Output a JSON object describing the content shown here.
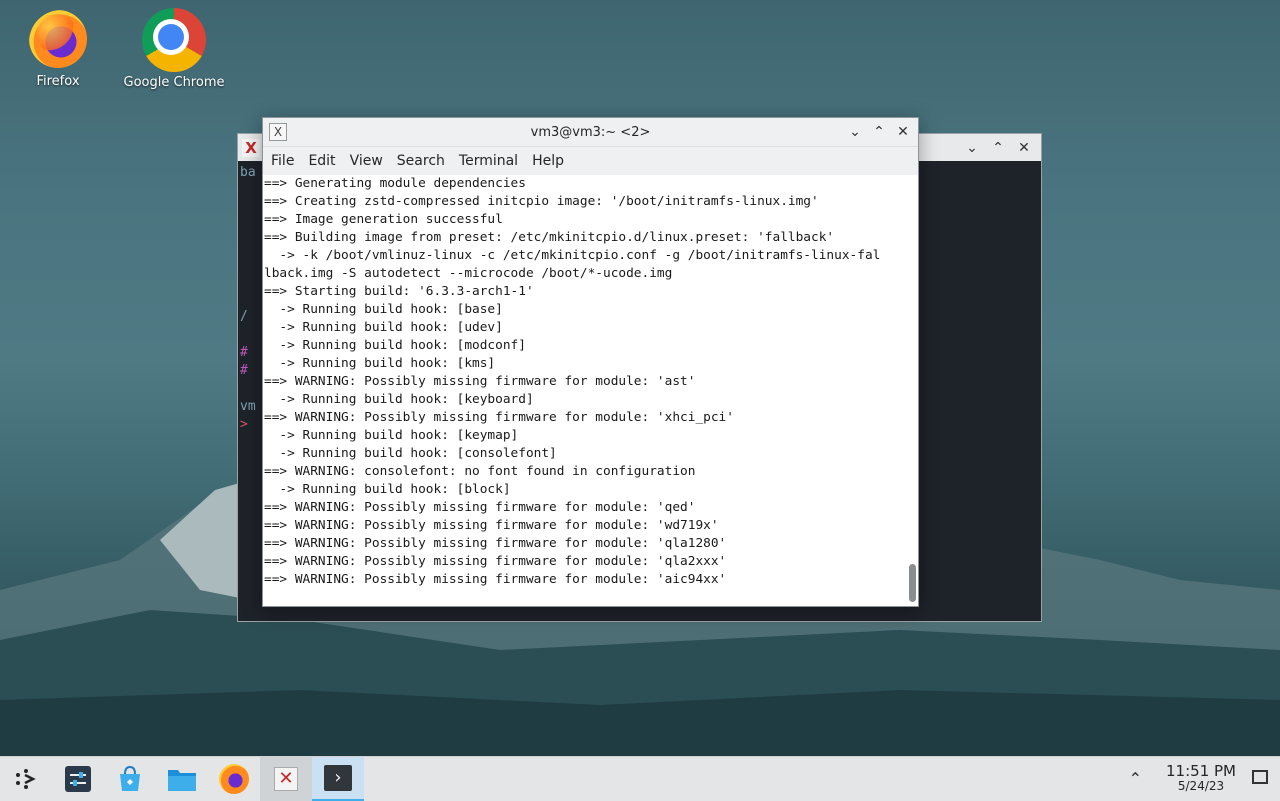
{
  "desktop": {
    "icons": [
      {
        "label": "Firefox",
        "icon": "firefox-icon"
      },
      {
        "label": "Google Chrome",
        "icon": "chrome-icon"
      }
    ]
  },
  "back_window": {
    "side_text": [
      "ba",
      "/",
      "#",
      "#",
      "vm",
      ">"
    ]
  },
  "terminal": {
    "title": "vm3@vm3:~ <2>",
    "menu": [
      "File",
      "Edit",
      "View",
      "Search",
      "Terminal",
      "Help"
    ],
    "lines": [
      "==> Generating module dependencies",
      "==> Creating zstd-compressed initcpio image: '/boot/initramfs-linux.img'",
      "==> Image generation successful",
      "==> Building image from preset: /etc/mkinitcpio.d/linux.preset: 'fallback'",
      "  -> -k /boot/vmlinuz-linux -c /etc/mkinitcpio.conf -g /boot/initramfs-linux-fal",
      "lback.img -S autodetect --microcode /boot/*-ucode.img",
      "==> Starting build: '6.3.3-arch1-1'",
      "  -> Running build hook: [base]",
      "  -> Running build hook: [udev]",
      "  -> Running build hook: [modconf]",
      "  -> Running build hook: [kms]",
      "==> WARNING: Possibly missing firmware for module: 'ast'",
      "  -> Running build hook: [keyboard]",
      "==> WARNING: Possibly missing firmware for module: 'xhci_pci'",
      "  -> Running build hook: [keymap]",
      "  -> Running build hook: [consolefont]",
      "==> WARNING: consolefont: no font found in configuration",
      "  -> Running build hook: [block]",
      "==> WARNING: Possibly missing firmware for module: 'qed'",
      "==> WARNING: Possibly missing firmware for module: 'wd719x'",
      "==> WARNING: Possibly missing firmware for module: 'qla1280'",
      "==> WARNING: Possibly missing firmware for module: 'qla2xxx'",
      "==> WARNING: Possibly missing firmware for module: 'aic94xx'"
    ]
  },
  "taskbar": {
    "items": [
      {
        "name": "app-launcher-icon"
      },
      {
        "name": "system-settings-icon"
      },
      {
        "name": "discover-store-icon"
      },
      {
        "name": "file-manager-icon"
      },
      {
        "name": "firefox-icon"
      },
      {
        "name": "xterm-icon"
      },
      {
        "name": "konsole-icon"
      }
    ],
    "clock_time": "11:51 PM",
    "clock_date": "5/24/23"
  }
}
